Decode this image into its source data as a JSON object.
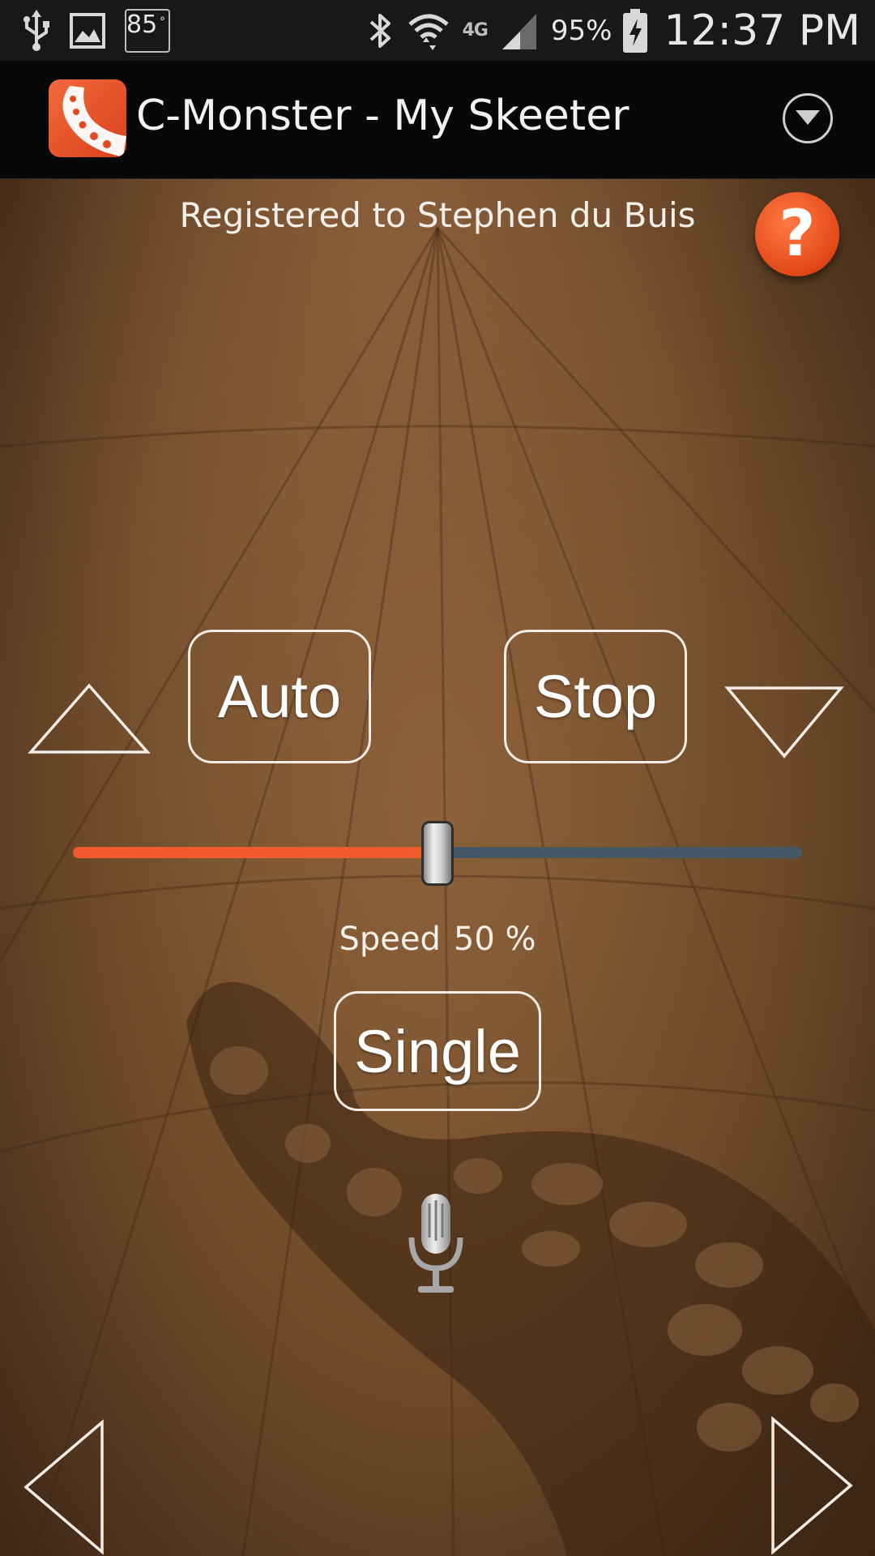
{
  "status_bar": {
    "icons_left": [
      "usb-icon",
      "gallery-icon",
      "temperature-badge"
    ],
    "temperature": "85",
    "temperature_unit": "°",
    "icons_right": [
      "bluetooth-icon",
      "wifi-icon",
      "lte-signal-icon",
      "battery-charging-icon"
    ],
    "network": "4G",
    "battery": "95%",
    "time": "12:37 PM"
  },
  "action_bar": {
    "title": "C-Monster - My Skeeter",
    "app_icon": "octopus-tentacle-icon",
    "overflow_icon": "chevron-down-circle-icon"
  },
  "main": {
    "registered_text": "Registered to Stephen du Buis",
    "help_label": "?",
    "buttons": {
      "auto": "Auto",
      "stop": "Stop",
      "single": "Single"
    },
    "speed": {
      "label": "Speed",
      "value": "50 %",
      "fraction": 0.5
    },
    "icons": {
      "up": "triangle-up-icon",
      "down": "triangle-down-icon",
      "left": "triangle-left-icon",
      "right": "triangle-right-icon",
      "mic": "microphone-icon"
    }
  },
  "colors": {
    "accent": "#ef5a2e",
    "slider_remaining": "#465766",
    "background_brown": "#7a5230",
    "action_bar": "#080808"
  }
}
